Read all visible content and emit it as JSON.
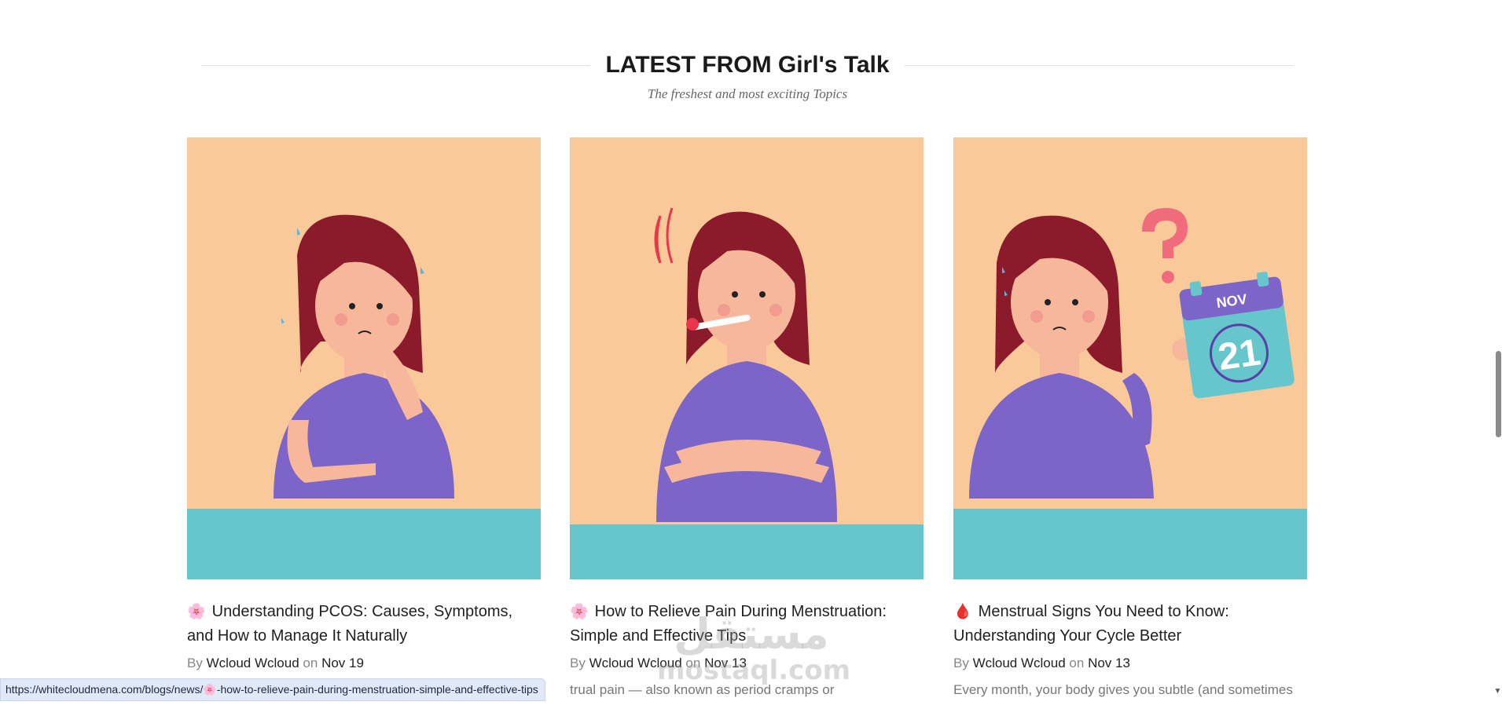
{
  "section": {
    "title": "LATEST FROM Girl's Talk",
    "subtitle": "The freshest and most exciting Topics"
  },
  "posts": [
    {
      "emoji": "🌸",
      "title": "Understanding PCOS: Causes, Symptoms, and How to Manage It Naturally",
      "by_label": "By",
      "author": "Wcloud Wcloud",
      "on_label": "on",
      "date": "Nov 19",
      "excerpt": ""
    },
    {
      "emoji": "🌸",
      "title": "How to Relieve Pain During Menstruation: Simple and Effective Tips",
      "by_label": "By",
      "author": "Wcloud Wcloud",
      "on_label": "on",
      "date": "Nov 13",
      "excerpt": "trual pain — also known as period cramps or"
    },
    {
      "emoji": "🩸",
      "title": "Menstrual Signs You Need to Know: Understanding Your Cycle Better",
      "by_label": "By",
      "author": "Wcloud Wcloud",
      "on_label": "on",
      "date": "Nov 13",
      "excerpt": "Every month, your body gives you subtle (and sometimes"
    }
  ],
  "calendar": {
    "month": "NOV",
    "day": "21"
  },
  "status_url": "https://whitecloudmena.com/blogs/news/🌸-how-to-relieve-pain-during-menstruation-simple-and-effective-tips",
  "watermark": {
    "top": "مستقل",
    "bottom": "mostaql.com"
  },
  "colors": {
    "peach_bg": "#f9c99a",
    "teal": "#67c6cc",
    "hair": "#8b1a2b",
    "shirt": "#7c64c8",
    "skin": "#f6b79a"
  }
}
